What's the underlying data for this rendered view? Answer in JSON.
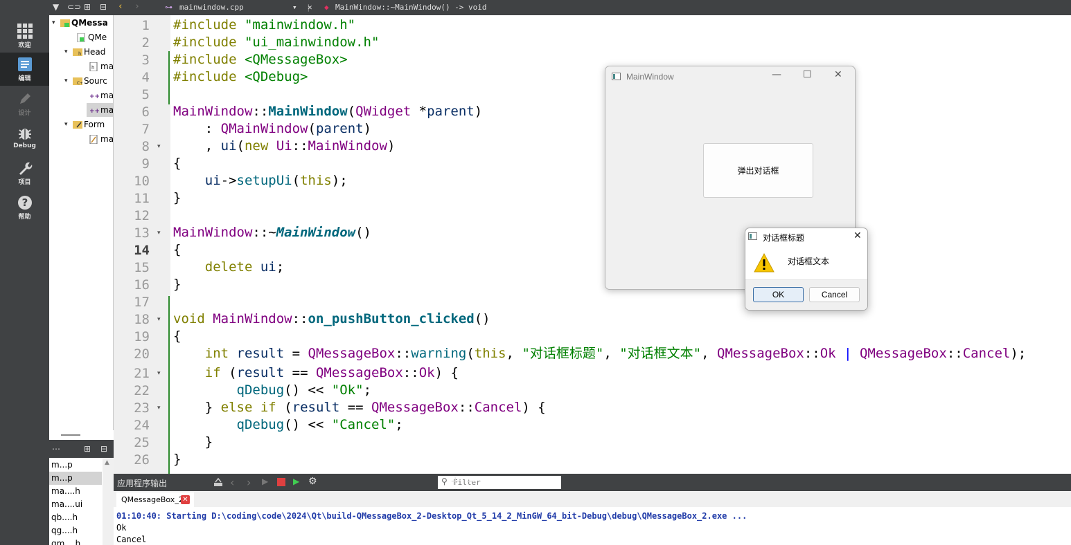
{
  "modes": [
    {
      "label": "欢迎",
      "icon": "grid-icon"
    },
    {
      "label": "编辑",
      "icon": "edit-doc-icon",
      "active": true
    },
    {
      "label": "设计",
      "icon": "pencil-icon",
      "disabled": true
    },
    {
      "label": "Debug",
      "icon": "bug-icon"
    },
    {
      "label": "项目",
      "icon": "wrench-icon"
    },
    {
      "label": "帮助",
      "icon": "help-icon"
    }
  ],
  "tree": {
    "items": [
      {
        "label": "QMessa",
        "level": 0,
        "arrow": "▾",
        "icon": "qt-project-icon",
        "bold": true
      },
      {
        "label": "QMe",
        "level": 1,
        "arrow": "",
        "icon": "pro-file-icon"
      },
      {
        "label": "Head",
        "level": 1,
        "arrow": "▾",
        "icon": "folder-h-icon"
      },
      {
        "label": "ma",
        "level": 2,
        "arrow": "",
        "icon": "header-file-icon"
      },
      {
        "label": "Sourc",
        "level": 1,
        "arrow": "▾",
        "icon": "folder-cpp-icon"
      },
      {
        "label": "ma",
        "level": 2,
        "arrow": "",
        "icon": "cpp-file-icon"
      },
      {
        "label": "ma",
        "level": 2,
        "arrow": "",
        "icon": "cpp-file-icon",
        "selected": true
      },
      {
        "label": "Form",
        "level": 1,
        "arrow": "▾",
        "icon": "folder-ui-icon"
      },
      {
        "label": "ma",
        "level": 2,
        "arrow": "",
        "icon": "ui-file-icon"
      }
    ]
  },
  "open_docs": [
    {
      "label": "m...p"
    },
    {
      "label": "m...p",
      "selected": true
    },
    {
      "label": "ma....h"
    },
    {
      "label": "ma....ui"
    },
    {
      "label": "qb....h"
    },
    {
      "label": "qg....h"
    },
    {
      "label": "qm....h"
    }
  ],
  "editor": {
    "file_name": "mainwindow.cpp",
    "symbol": "MainWindow::~MainWindow() -> void",
    "current_line": 14,
    "lines": [
      [
        [
          "kw",
          "#include"
        ],
        [
          "",
          " "
        ],
        [
          "str",
          "\"mainwindow.h\""
        ]
      ],
      [
        [
          "kw",
          "#include"
        ],
        [
          "",
          " "
        ],
        [
          "str",
          "\"ui_mainwindow.h\""
        ]
      ],
      [
        [
          "kw",
          "#include"
        ],
        [
          "",
          " "
        ],
        [
          "str",
          "<QMessageBox>"
        ]
      ],
      [
        [
          "kw",
          "#include"
        ],
        [
          "",
          " "
        ],
        [
          "str",
          "<QDebug>"
        ]
      ],
      [],
      [
        [
          "ty",
          "MainWindow"
        ],
        [
          "",
          "::"
        ],
        [
          "fnb",
          "MainWindow"
        ],
        [
          "",
          "("
        ],
        [
          "ty",
          "QWidget"
        ],
        [
          "",
          " *"
        ],
        [
          "var",
          "parent"
        ],
        [
          "",
          ")"
        ]
      ],
      [
        [
          "",
          "    : "
        ],
        [
          "ty",
          "QMainWindow"
        ],
        [
          "",
          "("
        ],
        [
          "var",
          "parent"
        ],
        [
          "",
          ")"
        ]
      ],
      [
        [
          "",
          "    , "
        ],
        [
          "var",
          "ui"
        ],
        [
          "",
          "("
        ],
        [
          "kw",
          "new"
        ],
        [
          "",
          " "
        ],
        [
          "ty",
          "Ui"
        ],
        [
          "",
          "::"
        ],
        [
          "ty",
          "MainWindow"
        ],
        [
          "",
          ")"
        ]
      ],
      [
        [
          "",
          "{"
        ]
      ],
      [
        [
          "",
          "    "
        ],
        [
          "var",
          "ui"
        ],
        [
          "",
          "->"
        ],
        [
          "fn",
          "setupUi"
        ],
        [
          "",
          "("
        ],
        [
          "kw",
          "this"
        ],
        [
          "",
          ");"
        ]
      ],
      [
        [
          "",
          "}"
        ]
      ],
      [],
      [
        [
          "ty",
          "MainWindow"
        ],
        [
          "",
          "::~"
        ],
        [
          "fni",
          "MainWindow"
        ],
        [
          "",
          "()"
        ]
      ],
      [
        [
          "",
          "{"
        ]
      ],
      [
        [
          "",
          "    "
        ],
        [
          "kw",
          "delete"
        ],
        [
          "",
          " "
        ],
        [
          "var",
          "ui"
        ],
        [
          "",
          ";"
        ]
      ],
      [
        [
          "",
          "}"
        ]
      ],
      [],
      [
        [
          "kw",
          "void"
        ],
        [
          "",
          " "
        ],
        [
          "ty",
          "MainWindow"
        ],
        [
          "",
          "::"
        ],
        [
          "fnb",
          "on_pushButton_clicked"
        ],
        [
          "",
          "()"
        ]
      ],
      [
        [
          "",
          "{"
        ]
      ],
      [
        [
          "",
          "    "
        ],
        [
          "kw",
          "int"
        ],
        [
          "",
          " "
        ],
        [
          "var",
          "result"
        ],
        [
          "",
          " = "
        ],
        [
          "ty",
          "QMessageBox"
        ],
        [
          "",
          "::"
        ],
        [
          "fn",
          "warning"
        ],
        [
          "",
          "("
        ],
        [
          "kw",
          "this"
        ],
        [
          "",
          ", "
        ],
        [
          "str",
          "\"对话框标题\""
        ],
        [
          "",
          ", "
        ],
        [
          "str",
          "\"对话框文本\""
        ],
        [
          "",
          ", "
        ],
        [
          "ty",
          "QMessageBox"
        ],
        [
          "",
          "::"
        ],
        [
          "ty",
          "Ok"
        ],
        [
          "",
          " "
        ],
        [
          "ac",
          "|"
        ],
        [
          "",
          " "
        ],
        [
          "ty",
          "QMessageBox"
        ],
        [
          "",
          "::"
        ],
        [
          "ty",
          "Cancel"
        ],
        [
          "",
          ");"
        ]
      ],
      [
        [
          "",
          "    "
        ],
        [
          "kw",
          "if"
        ],
        [
          "",
          " ("
        ],
        [
          "var",
          "result"
        ],
        [
          "",
          " == "
        ],
        [
          "ty",
          "QMessageBox"
        ],
        [
          "",
          "::"
        ],
        [
          "ty",
          "Ok"
        ],
        [
          "",
          ") {"
        ]
      ],
      [
        [
          "",
          "        "
        ],
        [
          "fn",
          "qDebug"
        ],
        [
          "",
          "() << "
        ],
        [
          "str",
          "\"Ok\""
        ],
        [
          "",
          ";"
        ]
      ],
      [
        [
          "",
          "    } "
        ],
        [
          "kw",
          "else"
        ],
        [
          "",
          " "
        ],
        [
          "kw",
          "if"
        ],
        [
          "",
          " ("
        ],
        [
          "var",
          "result"
        ],
        [
          "",
          " == "
        ],
        [
          "ty",
          "QMessageBox"
        ],
        [
          "",
          "::"
        ],
        [
          "ty",
          "Cancel"
        ],
        [
          "",
          ") {"
        ]
      ],
      [
        [
          "",
          "        "
        ],
        [
          "fn",
          "qDebug"
        ],
        [
          "",
          "() << "
        ],
        [
          "str",
          "\"Cancel\""
        ],
        [
          "",
          ";"
        ]
      ],
      [
        [
          "",
          "    }"
        ]
      ],
      [
        [
          "",
          "}"
        ]
      ]
    ],
    "line_numbers": [
      "1",
      "2",
      "3",
      "4",
      "5",
      "6",
      "7",
      "8",
      "9",
      "10",
      "11",
      "12",
      "13",
      "14",
      "15",
      "16",
      "17",
      "18",
      "19",
      "20",
      "21",
      "22",
      "23",
      "24",
      "25",
      "26"
    ]
  },
  "output": {
    "title": "应用程序输出",
    "filter_placeholder": "Filter",
    "tab": "QMessageBox_2",
    "lines": [
      {
        "text": "01:10:40: Starting D:\\coding\\code\\2024\\Qt\\build-QMessageBox_2-Desktop_Qt_5_14_2_MinGW_64_bit-Debug\\debug\\QMessageBox_2.exe ...",
        "color": "#1f3aa8",
        "bold": true
      },
      {
        "text": "Ok",
        "color": "#000000"
      },
      {
        "text": "Cancel",
        "color": "#000000"
      }
    ]
  },
  "main_window": {
    "title": "MainWindow",
    "button": "弹出对话框"
  },
  "dialog": {
    "title": "对话框标题",
    "text": "对话框文本",
    "ok": "OK",
    "cancel": "Cancel"
  },
  "colors": {
    "sidebar": "#404244",
    "keyword": "#808000",
    "string": "#008000",
    "type": "#800080",
    "function": "#00677c"
  }
}
